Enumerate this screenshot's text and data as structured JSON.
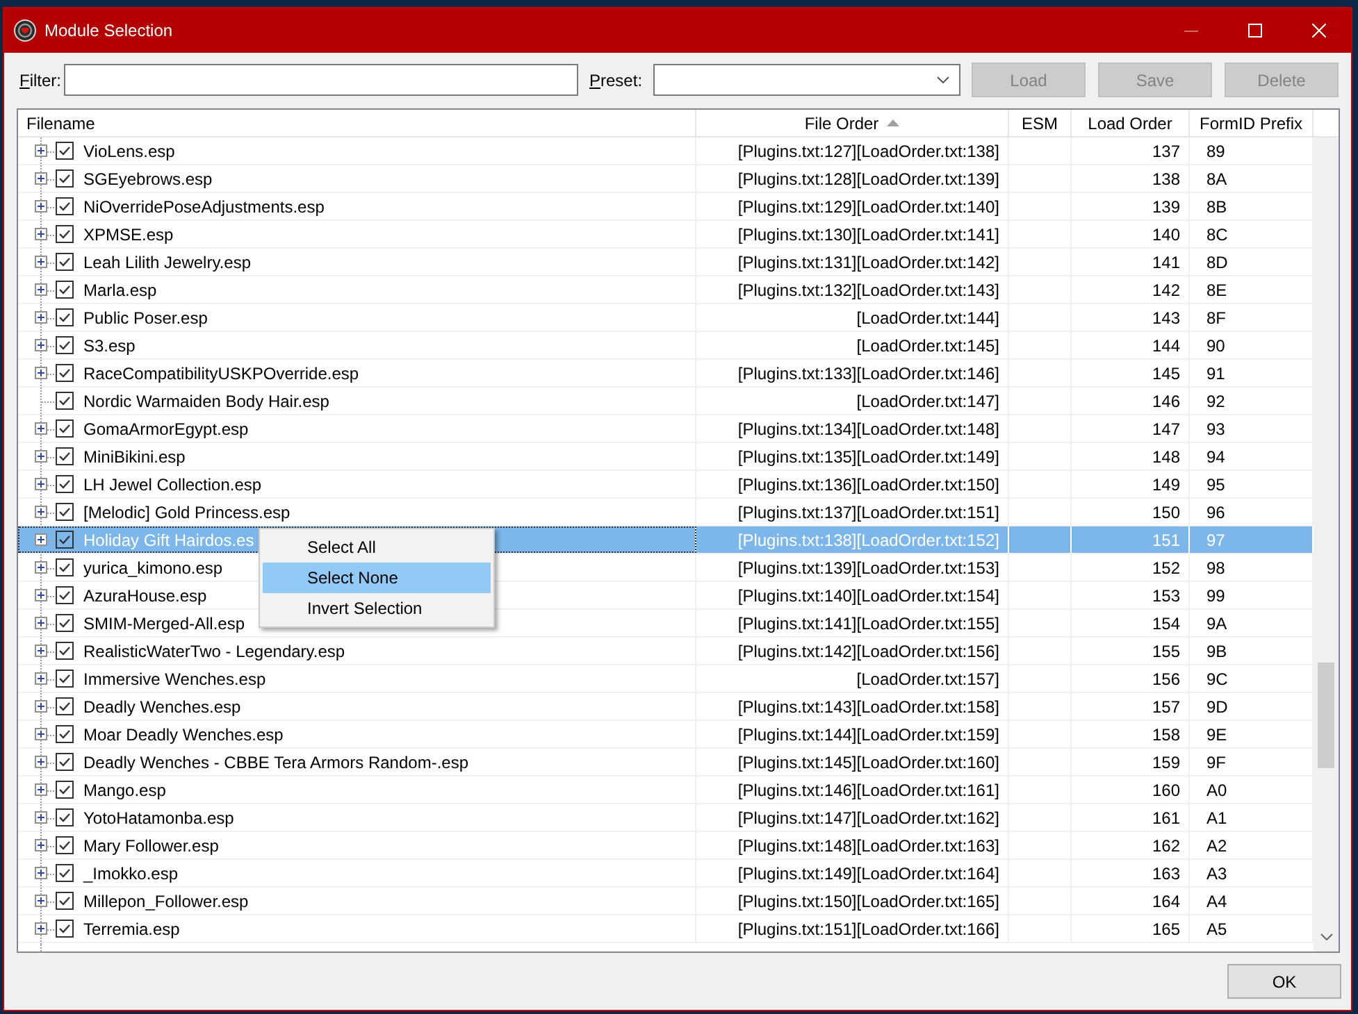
{
  "window": {
    "title": "Module Selection",
    "minimize_enabled": false
  },
  "toolbar": {
    "filter": {
      "label": "Filter:"
    },
    "preset": {
      "label": "Preset:"
    },
    "buttons": [
      {
        "label": "Load",
        "disabled": true
      },
      {
        "label": "Save",
        "disabled": true
      },
      {
        "label": "Delete",
        "disabled": true
      }
    ]
  },
  "table": {
    "columns": [
      {
        "label": "Filename",
        "sorted": false
      },
      {
        "label": "File Order",
        "sorted": true
      },
      {
        "label": "ESM",
        "sorted": false
      },
      {
        "label": "Load Order",
        "sorted": false
      },
      {
        "label": "FormID Prefix",
        "sorted": false
      }
    ],
    "rows": [
      {
        "filename": "VioLens.esp",
        "expandable": true,
        "checked": true,
        "file_order": "[Plugins.txt:127][LoadOrder.txt:138]",
        "load_order": "137",
        "formid_prefix": "89",
        "selected": false
      },
      {
        "filename": "SGEyebrows.esp",
        "expandable": true,
        "checked": true,
        "file_order": "[Plugins.txt:128][LoadOrder.txt:139]",
        "load_order": "138",
        "formid_prefix": "8A",
        "selected": false
      },
      {
        "filename": "NiOverridePoseAdjustments.esp",
        "expandable": true,
        "checked": true,
        "file_order": "[Plugins.txt:129][LoadOrder.txt:140]",
        "load_order": "139",
        "formid_prefix": "8B",
        "selected": false
      },
      {
        "filename": "XPMSE.esp",
        "expandable": true,
        "checked": true,
        "file_order": "[Plugins.txt:130][LoadOrder.txt:141]",
        "load_order": "140",
        "formid_prefix": "8C",
        "selected": false
      },
      {
        "filename": "Leah Lilith Jewelry.esp",
        "expandable": true,
        "checked": true,
        "file_order": "[Plugins.txt:131][LoadOrder.txt:142]",
        "load_order": "141",
        "formid_prefix": "8D",
        "selected": false
      },
      {
        "filename": "Marla.esp",
        "expandable": true,
        "checked": true,
        "file_order": "[Plugins.txt:132][LoadOrder.txt:143]",
        "load_order": "142",
        "formid_prefix": "8E",
        "selected": false
      },
      {
        "filename": "Public Poser.esp",
        "expandable": true,
        "checked": true,
        "file_order": "[LoadOrder.txt:144]",
        "load_order": "143",
        "formid_prefix": "8F",
        "selected": false
      },
      {
        "filename": "S3.esp",
        "expandable": true,
        "checked": true,
        "file_order": "[LoadOrder.txt:145]",
        "load_order": "144",
        "formid_prefix": "90",
        "selected": false
      },
      {
        "filename": "RaceCompatibilityUSKPOverride.esp",
        "expandable": true,
        "checked": true,
        "file_order": "[Plugins.txt:133][LoadOrder.txt:146]",
        "load_order": "145",
        "formid_prefix": "91",
        "selected": false
      },
      {
        "filename": "Nordic Warmaiden Body Hair.esp",
        "expandable": false,
        "checked": true,
        "file_order": "[LoadOrder.txt:147]",
        "load_order": "146",
        "formid_prefix": "92",
        "selected": false
      },
      {
        "filename": "GomaArmorEgypt.esp",
        "expandable": true,
        "checked": true,
        "file_order": "[Plugins.txt:134][LoadOrder.txt:148]",
        "load_order": "147",
        "formid_prefix": "93",
        "selected": false
      },
      {
        "filename": "MiniBikini.esp",
        "expandable": true,
        "checked": true,
        "file_order": "[Plugins.txt:135][LoadOrder.txt:149]",
        "load_order": "148",
        "formid_prefix": "94",
        "selected": false
      },
      {
        "filename": "LH Jewel Collection.esp",
        "expandable": true,
        "checked": true,
        "file_order": "[Plugins.txt:136][LoadOrder.txt:150]",
        "load_order": "149",
        "formid_prefix": "95",
        "selected": false
      },
      {
        "filename": "[Melodic] Gold Princess.esp",
        "expandable": true,
        "checked": true,
        "file_order": "[Plugins.txt:137][LoadOrder.txt:151]",
        "load_order": "150",
        "formid_prefix": "96",
        "selected": false
      },
      {
        "filename": "Holiday Gift Hairdos.es",
        "expandable": true,
        "checked": true,
        "file_order": "[Plugins.txt:138][LoadOrder.txt:152]",
        "load_order": "151",
        "formid_prefix": "97",
        "selected": true
      },
      {
        "filename": "yurica_kimono.esp",
        "expandable": true,
        "checked": true,
        "file_order": "[Plugins.txt:139][LoadOrder.txt:153]",
        "load_order": "152",
        "formid_prefix": "98",
        "selected": false
      },
      {
        "filename": "AzuraHouse.esp",
        "expandable": true,
        "checked": true,
        "file_order": "[Plugins.txt:140][LoadOrder.txt:154]",
        "load_order": "153",
        "formid_prefix": "99",
        "selected": false
      },
      {
        "filename": "SMIM-Merged-All.esp",
        "expandable": true,
        "checked": true,
        "file_order": "[Plugins.txt:141][LoadOrder.txt:155]",
        "load_order": "154",
        "formid_prefix": "9A",
        "selected": false
      },
      {
        "filename": "RealisticWaterTwo - Legendary.esp",
        "expandable": true,
        "checked": true,
        "file_order": "[Plugins.txt:142][LoadOrder.txt:156]",
        "load_order": "155",
        "formid_prefix": "9B",
        "selected": false
      },
      {
        "filename": "Immersive Wenches.esp",
        "expandable": true,
        "checked": true,
        "file_order": "[LoadOrder.txt:157]",
        "load_order": "156",
        "formid_prefix": "9C",
        "selected": false
      },
      {
        "filename": "Deadly Wenches.esp",
        "expandable": true,
        "checked": true,
        "file_order": "[Plugins.txt:143][LoadOrder.txt:158]",
        "load_order": "157",
        "formid_prefix": "9D",
        "selected": false
      },
      {
        "filename": "Moar Deadly Wenches.esp",
        "expandable": true,
        "checked": true,
        "file_order": "[Plugins.txt:144][LoadOrder.txt:159]",
        "load_order": "158",
        "formid_prefix": "9E",
        "selected": false
      },
      {
        "filename": "Deadly Wenches - CBBE Tera Armors Random-.esp",
        "expandable": true,
        "checked": true,
        "file_order": "[Plugins.txt:145][LoadOrder.txt:160]",
        "load_order": "159",
        "formid_prefix": "9F",
        "selected": false
      },
      {
        "filename": "Mango.esp",
        "expandable": true,
        "checked": true,
        "file_order": "[Plugins.txt:146][LoadOrder.txt:161]",
        "load_order": "160",
        "formid_prefix": "A0",
        "selected": false
      },
      {
        "filename": "YotoHatamonba.esp",
        "expandable": true,
        "checked": true,
        "file_order": "[Plugins.txt:147][LoadOrder.txt:162]",
        "load_order": "161",
        "formid_prefix": "A1",
        "selected": false
      },
      {
        "filename": "Mary Follower.esp",
        "expandable": true,
        "checked": true,
        "file_order": "[Plugins.txt:148][LoadOrder.txt:163]",
        "load_order": "162",
        "formid_prefix": "A2",
        "selected": false
      },
      {
        "filename": "_Imokko.esp",
        "expandable": true,
        "checked": true,
        "file_order": "[Plugins.txt:149][LoadOrder.txt:164]",
        "load_order": "163",
        "formid_prefix": "A3",
        "selected": false
      },
      {
        "filename": "Millepon_Follower.esp",
        "expandable": true,
        "checked": true,
        "file_order": "[Plugins.txt:150][LoadOrder.txt:165]",
        "load_order": "164",
        "formid_prefix": "A4",
        "selected": false
      },
      {
        "filename": "Terremia.esp",
        "expandable": true,
        "checked": true,
        "file_order": "[Plugins.txt:151][LoadOrder.txt:166]",
        "load_order": "165",
        "formid_prefix": "A5",
        "selected": false
      }
    ]
  },
  "context_menu": {
    "items": [
      {
        "label": "Select All",
        "selected": false
      },
      {
        "label": "Select None",
        "selected": true
      },
      {
        "label": "Invert Selection",
        "selected": false
      }
    ]
  },
  "footer": {
    "buttons": [
      {
        "label": "OK",
        "disabled": false
      }
    ]
  }
}
